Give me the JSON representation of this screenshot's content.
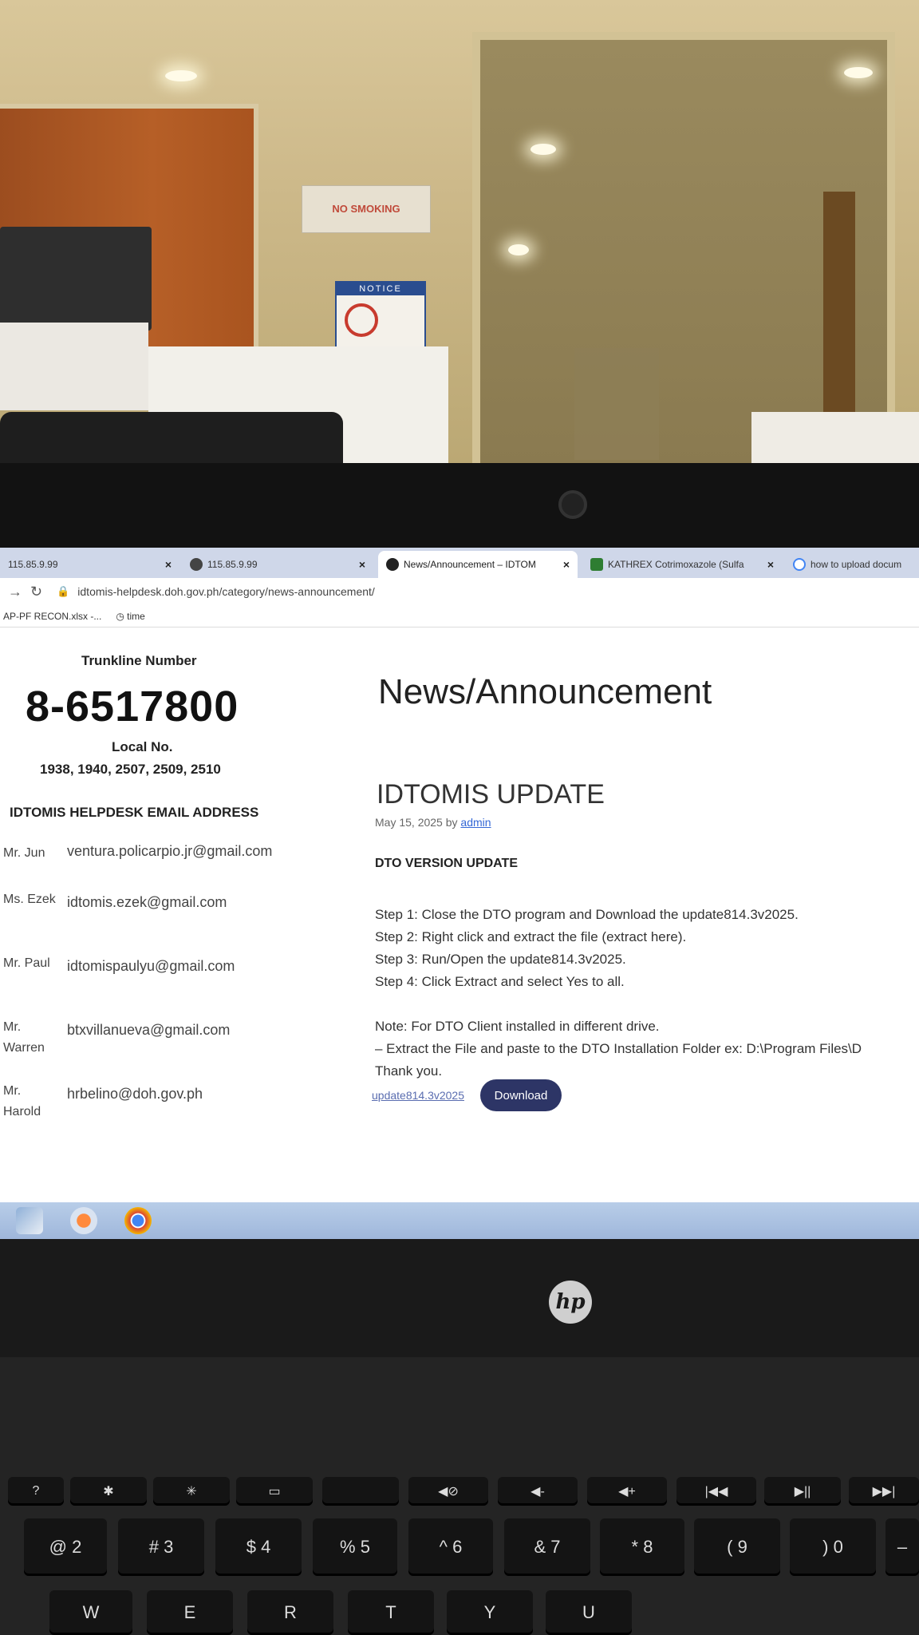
{
  "environment": {
    "room_sign": "NO SMOKING",
    "notice_sign": "NOTICE",
    "laptop_brand": "hp"
  },
  "browser": {
    "tabs": [
      {
        "label": "115.85.9.99"
      },
      {
        "label": "115.85.9.99"
      },
      {
        "label": "News/Announcement – IDTOM",
        "active": true
      },
      {
        "label": "KATHREX Cotrimoxazole (Sulfa"
      },
      {
        "label": "how to upload docum"
      }
    ],
    "url": "idtomis-helpdesk.doh.gov.ph/category/news-announcement/",
    "bookmarks": [
      "AP-PF RECON.xlsx -...",
      "time"
    ]
  },
  "sidebar": {
    "trunkline_label": "Trunkline Number",
    "trunkline_number": "8-6517800",
    "local_label": "Local No.",
    "local_numbers": "1938, 1940, 2507, 2509, 2510",
    "email_heading": "IDTOMIS HELPDESK EMAIL ADDRESS",
    "contacts": [
      {
        "name": "Mr. Jun",
        "email": "ventura.policarpio.jr@gmail.com"
      },
      {
        "name": "Ms. Ezek",
        "email": "idtomis.ezek@gmail.com"
      },
      {
        "name": "Mr. Paul",
        "email": "idtomispaulyu@gmail.com"
      },
      {
        "name": "Mr. Warren",
        "email": "btxvillanueva@gmail.com"
      },
      {
        "name": "Mr. Harold",
        "email": "hrbelino@doh.gov.ph"
      }
    ]
  },
  "main": {
    "page_title": "News/Announcement",
    "post_title": "IDTOMIS UPDATE",
    "post_date": "May 15, 2025",
    "post_by": "by",
    "post_author": "admin",
    "section_heading": "DTO VERSION UPDATE",
    "steps": [
      "Step 1: Close the DTO program and Download the update814.3v2025.",
      "Step 2: Right click and extract the file (extract here).",
      "Step 3: Run/Open the update814.3v2025.",
      "Step 4: Click Extract and select Yes to all."
    ],
    "note_lines": [
      "Note: For DTO Client installed in different drive.",
      "– Extract the File and paste to the DTO Installation Folder ex: D:\\Program Files\\D",
      "Thank you."
    ],
    "download_link": "update814.3v2025",
    "download_button": "Download"
  },
  "keyboard": {
    "row_numbers": [
      "2",
      "3",
      "4",
      "5",
      "6",
      "7",
      "8",
      "9",
      "0"
    ],
    "row_number_shift": [
      "@",
      "#",
      "$",
      "%",
      "^",
      "&",
      "*",
      "(",
      ")"
    ],
    "row_letters": [
      "W",
      "E",
      "R",
      "T",
      "Y",
      "U"
    ]
  }
}
